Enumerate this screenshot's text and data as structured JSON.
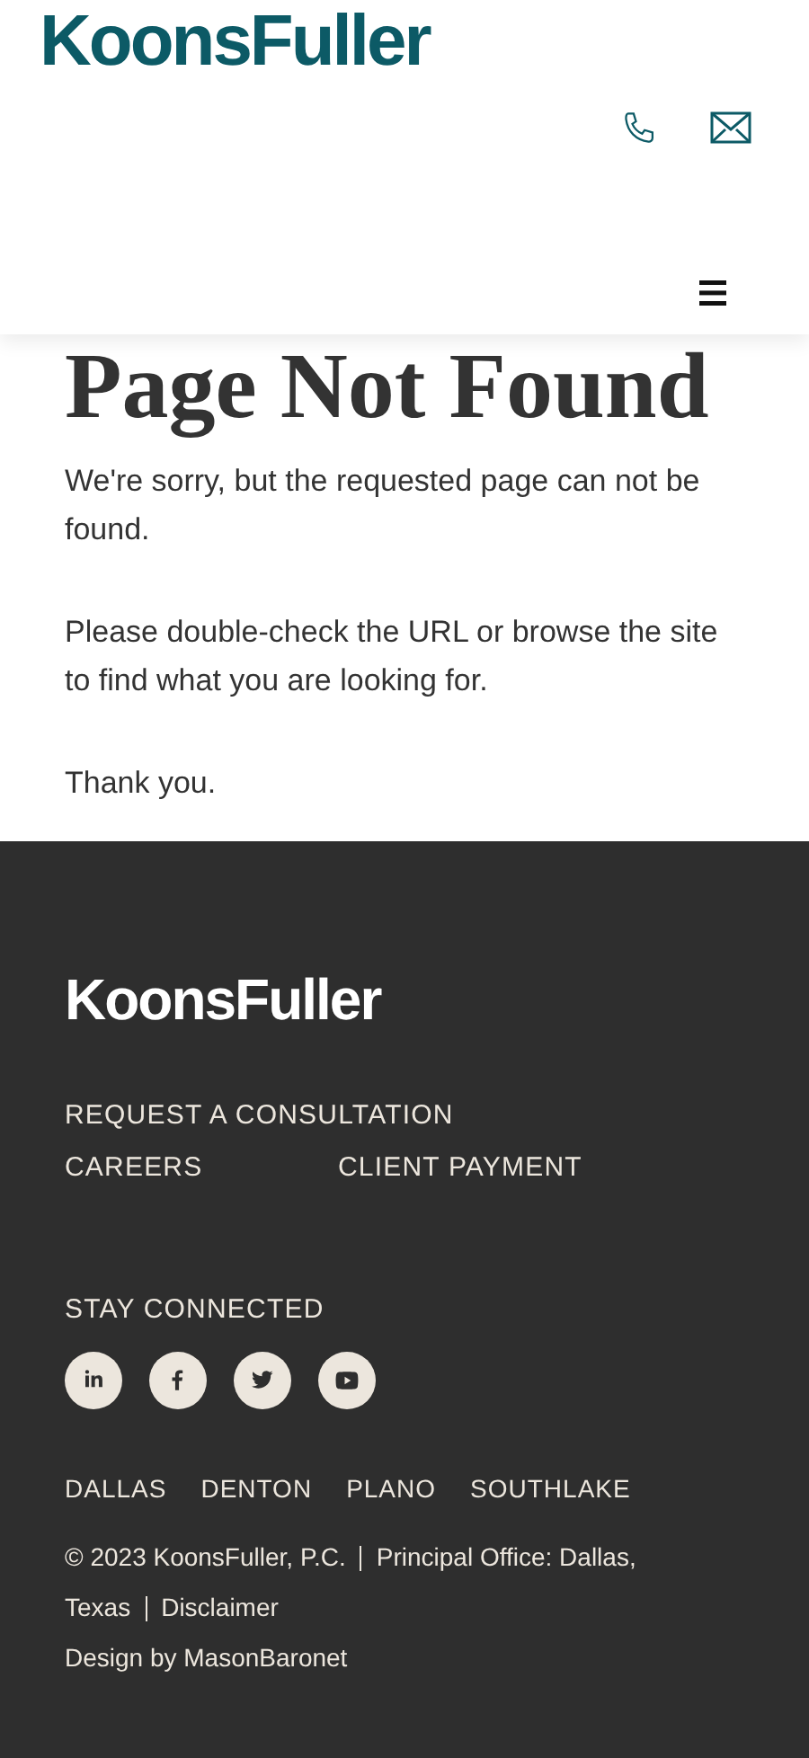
{
  "header": {
    "logo": "KoonsFuller"
  },
  "page": {
    "title": "Page Not Found",
    "paragraphs": [
      "We're sorry, but the requested page can not be found.",
      "Please double-check the URL or browse the site to find what you are looking for.",
      "Thank you."
    ]
  },
  "footer": {
    "logo": "KoonsFuller",
    "links": [
      "REQUEST A CONSULTATION",
      "CAREERS",
      "CLIENT PAYMENT"
    ],
    "social_heading": "STAY CONNECTED",
    "social": [
      {
        "kind": "linkedin"
      },
      {
        "kind": "facebook"
      },
      {
        "kind": "twitter"
      },
      {
        "kind": "youtube"
      }
    ],
    "offices": [
      "DALLAS",
      "DENTON",
      "PLANO",
      "SOUTHLAKE"
    ],
    "copyright": "© 2023 KoonsFuller, P.C.",
    "office_note": "Principal Office: Dallas, Texas",
    "disclaimer": "Disclaimer",
    "credit": "Design by MasonBaronet"
  }
}
